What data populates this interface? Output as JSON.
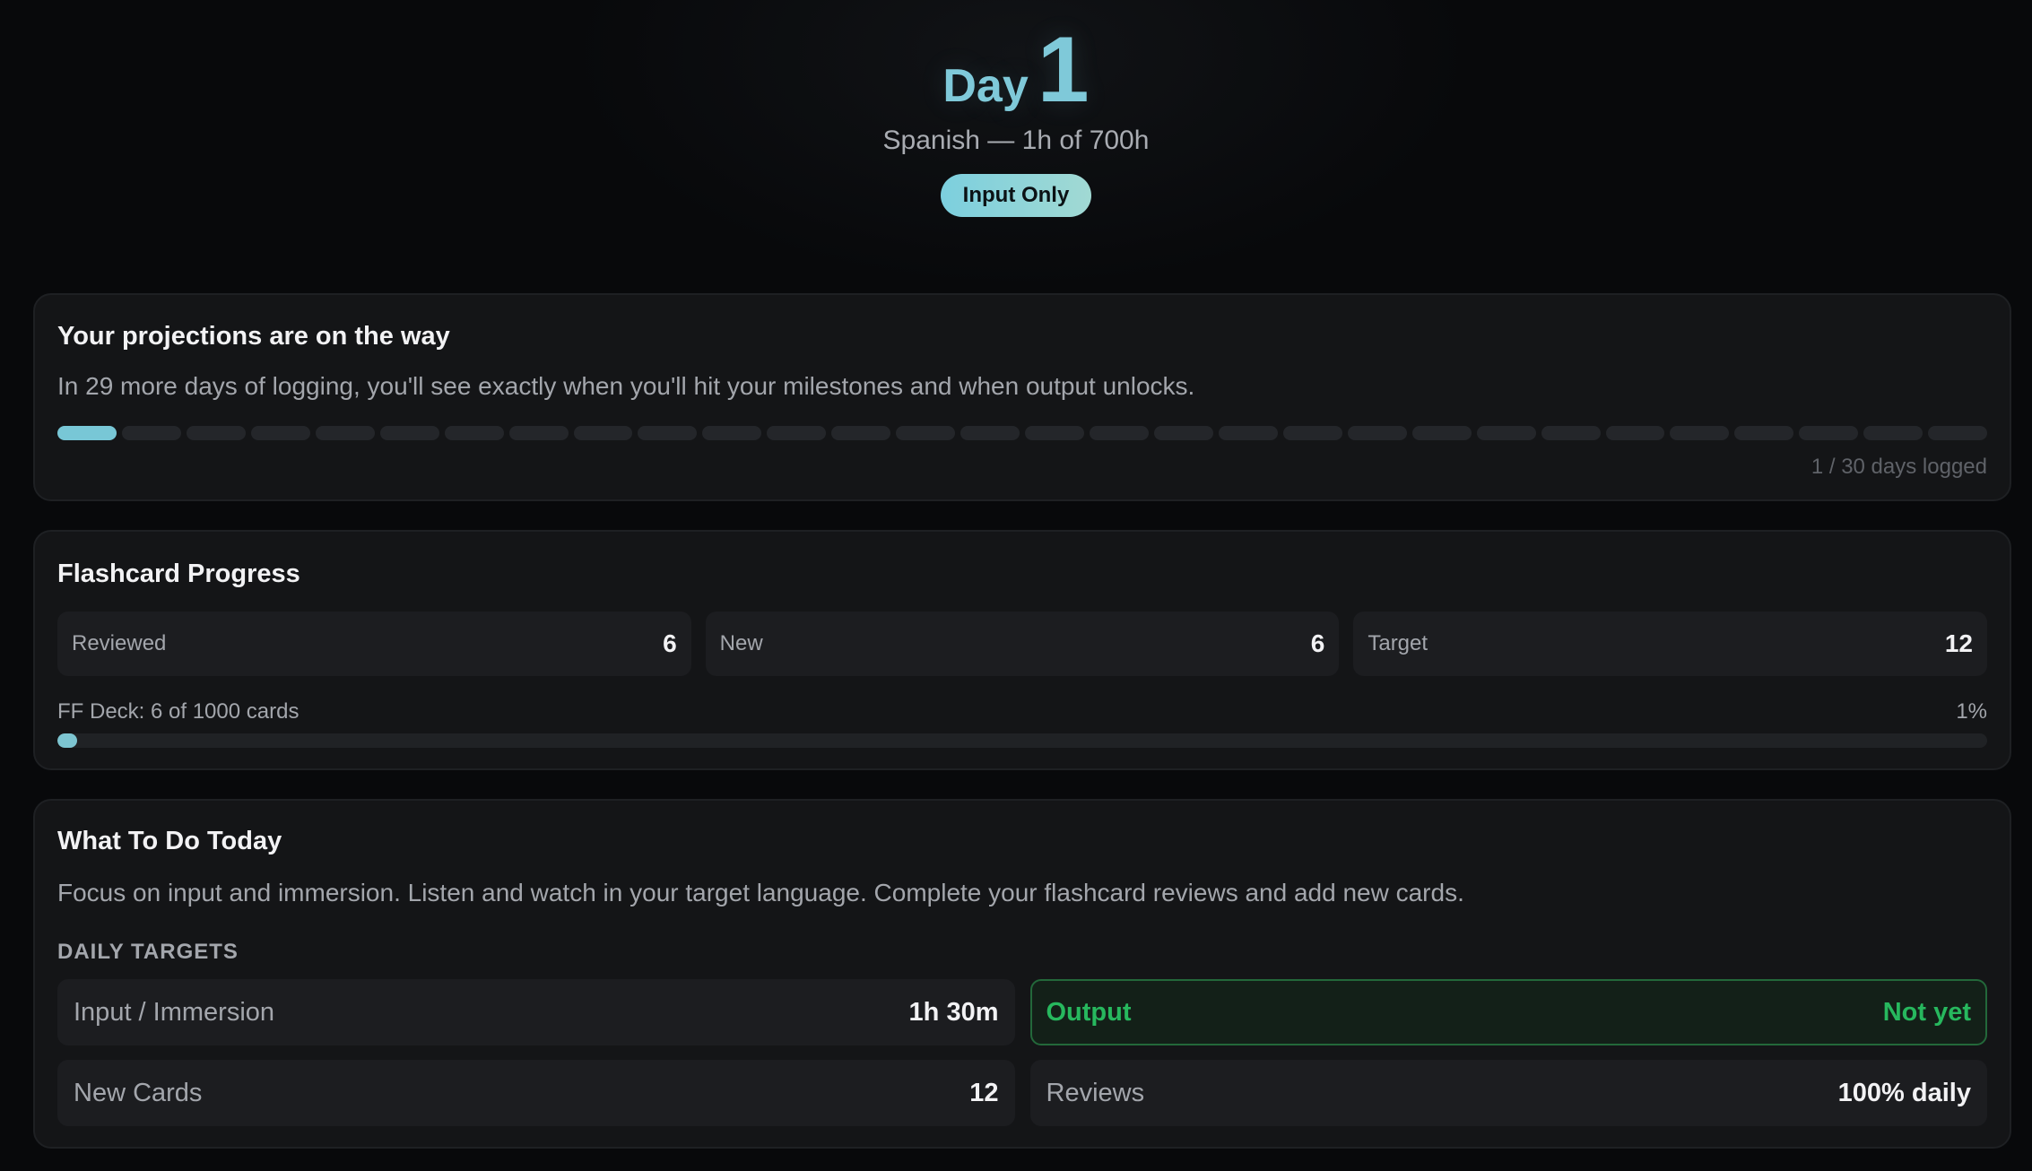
{
  "header": {
    "day_word": "Day",
    "day_number": "1",
    "subtitle": "Spanish — 1h of 700h",
    "phase_badge": "Input Only"
  },
  "projections": {
    "title": "Your projections are on the way",
    "message": "In 29 more days of logging, you'll see exactly when you'll hit your milestones and when output unlocks.",
    "days_logged": 1,
    "days_total": 30,
    "days_logged_label": "1 / 30 days logged"
  },
  "flashcards": {
    "title": "Flashcard Progress",
    "stats": [
      {
        "label": "Reviewed",
        "value": "6"
      },
      {
        "label": "New",
        "value": "6"
      },
      {
        "label": "Target",
        "value": "12"
      }
    ],
    "deck_label": "FF Deck: 6 of 1000 cards",
    "deck_percent_label": "1%",
    "deck_progress": 0.01
  },
  "today": {
    "title": "What To Do Today",
    "message": "Focus on input and immersion. Listen and watch in your target language. Complete your flashcard reviews and add new cards.",
    "section_label": "DAILY TARGETS",
    "targets": [
      {
        "label": "Input / Immersion",
        "value": "1h 30m"
      },
      {
        "label": "Output",
        "value": "Not yet"
      },
      {
        "label": "New Cards",
        "value": "12"
      },
      {
        "label": "Reviews",
        "value": "100% daily"
      }
    ]
  },
  "colors": {
    "accent": "#7fc9d9",
    "output_locked": "#27b85e",
    "background": "#08090b",
    "card": "#141517"
  }
}
